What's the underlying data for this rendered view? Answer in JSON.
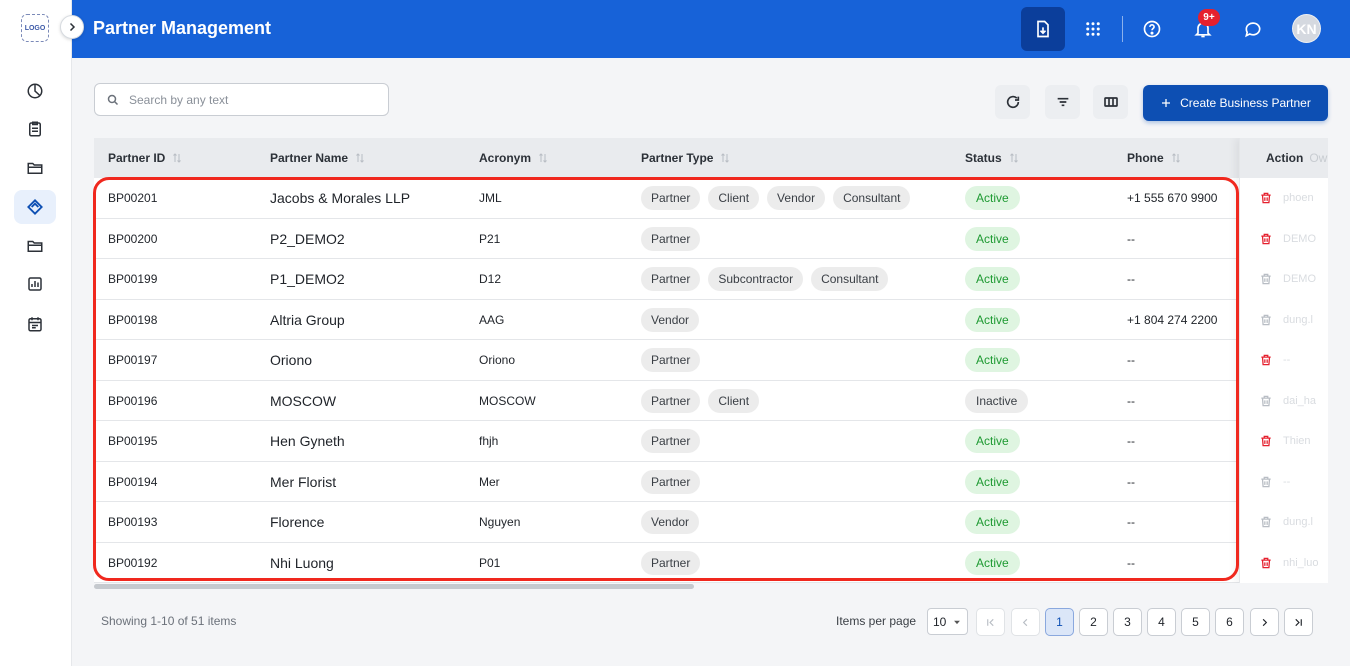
{
  "app": {
    "logo_text": "LOGO"
  },
  "header": {
    "title": "Partner Management",
    "notification_badge": "9+",
    "avatar_initials": "KN"
  },
  "toolbar": {
    "search_placeholder": "Search by any text",
    "create_label": "Create Business Partner"
  },
  "table": {
    "columns": [
      "Partner ID",
      "Partner Name",
      "Acronym",
      "Partner Type",
      "Status",
      "Phone"
    ],
    "action_column": "Action",
    "action_ghost_header": "Ow",
    "rows": [
      {
        "id": "BP00201",
        "name": "Jacobs & Morales LLP",
        "acronym": "JML",
        "types": [
          "Partner",
          "Client",
          "Vendor",
          "Consultant"
        ],
        "status": "Active",
        "phone": "+1 555 670 9900",
        "delete_enabled": true,
        "ghost": "phoen"
      },
      {
        "id": "BP00200",
        "name": "P2_DEMO2",
        "acronym": "P21",
        "types": [
          "Partner"
        ],
        "status": "Active",
        "phone": "--",
        "delete_enabled": true,
        "ghost": "DEMO"
      },
      {
        "id": "BP00199",
        "name": "P1_DEMO2",
        "acronym": "D12",
        "types": [
          "Partner",
          "Subcontractor",
          "Consultant"
        ],
        "status": "Active",
        "phone": "--",
        "delete_enabled": false,
        "ghost": "DEMO"
      },
      {
        "id": "BP00198",
        "name": "Altria Group",
        "acronym": "AAG",
        "types": [
          "Vendor"
        ],
        "status": "Active",
        "phone": "+1 804 274 2200",
        "delete_enabled": false,
        "ghost": "dung.l"
      },
      {
        "id": "BP00197",
        "name": "Oriono",
        "acronym": "Oriono",
        "types": [
          "Partner"
        ],
        "status": "Active",
        "phone": "--",
        "delete_enabled": true,
        "ghost": "--"
      },
      {
        "id": "BP00196",
        "name": "MOSCOW",
        "acronym": "MOSCOW",
        "types": [
          "Partner",
          "Client"
        ],
        "status": "Inactive",
        "phone": "--",
        "delete_enabled": false,
        "ghost": "dai_ha"
      },
      {
        "id": "BP00195",
        "name": "Hen Gyneth",
        "acronym": "fhjh",
        "types": [
          "Partner"
        ],
        "status": "Active",
        "phone": "--",
        "delete_enabled": true,
        "ghost": "Thien"
      },
      {
        "id": "BP00194",
        "name": "Mer Florist",
        "acronym": "Mer",
        "types": [
          "Partner"
        ],
        "status": "Active",
        "phone": "--",
        "delete_enabled": false,
        "ghost": "--"
      },
      {
        "id": "BP00193",
        "name": "Florence",
        "acronym": "Nguyen",
        "types": [
          "Vendor"
        ],
        "status": "Active",
        "phone": "--",
        "delete_enabled": false,
        "ghost": "dung.l"
      },
      {
        "id": "BP00192",
        "name": "Nhi Luong",
        "acronym": "P01",
        "types": [
          "Partner"
        ],
        "status": "Active",
        "phone": "--",
        "delete_enabled": true,
        "ghost": "nhi_luo"
      }
    ]
  },
  "footer": {
    "showing": "Showing 1-10 of 51 items",
    "items_per_page_label": "Items per page",
    "items_per_page_value": "10",
    "pages": [
      "1",
      "2",
      "3",
      "4",
      "5",
      "6"
    ],
    "current_page": "1"
  },
  "colors": {
    "header_blue": "#1762d8",
    "primary": "#0d4fb3",
    "active_green": "#1e9a32",
    "delete_red": "#e5202e",
    "highlight_red": "#f0281e"
  },
  "icons": {
    "sidebar": [
      "dashboard-pie-icon",
      "clipboard-icon",
      "folder-open-icon",
      "partner-handshake-icon",
      "folder-icon",
      "report-chart-icon",
      "calendar-icon"
    ],
    "header": [
      "download-file-icon",
      "apps-grid-icon",
      "help-icon",
      "bell-icon",
      "chat-icon"
    ]
  }
}
